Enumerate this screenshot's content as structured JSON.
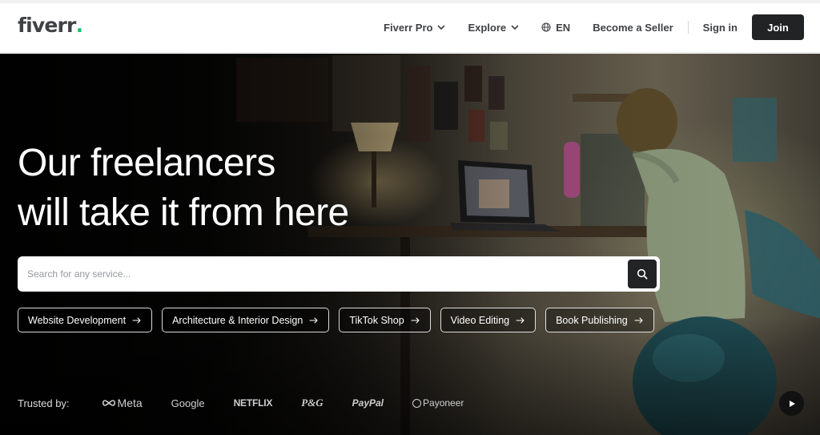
{
  "header": {
    "logo_text": "fiverr",
    "logo_dot": ".",
    "nav": {
      "fiverr_pro": "Fiverr Pro",
      "explore": "Explore",
      "language": "EN",
      "become_seller": "Become a Seller",
      "sign_in": "Sign in",
      "join": "Join"
    }
  },
  "hero": {
    "headline_line1": "Our freelancers",
    "headline_line2": "will take it from here",
    "search": {
      "placeholder": "Search for any service..."
    },
    "chips": [
      {
        "label": "Website Development"
      },
      {
        "label": "Architecture & Interior Design"
      },
      {
        "label": "TikTok Shop"
      },
      {
        "label": "Video Editing"
      },
      {
        "label": "Book Publishing"
      }
    ],
    "trusted": {
      "label": "Trusted by:",
      "brands": [
        "Meta",
        "Google",
        "NETFLIX",
        "P&G",
        "PayPal",
        "Payoneer"
      ]
    }
  },
  "colors": {
    "brand_green": "#1dbf73",
    "text_dark": "#404145",
    "button_dark": "#222325"
  },
  "icons": [
    "chevron-down-icon",
    "globe-icon",
    "search-icon",
    "arrow-right-icon",
    "play-icon"
  ]
}
